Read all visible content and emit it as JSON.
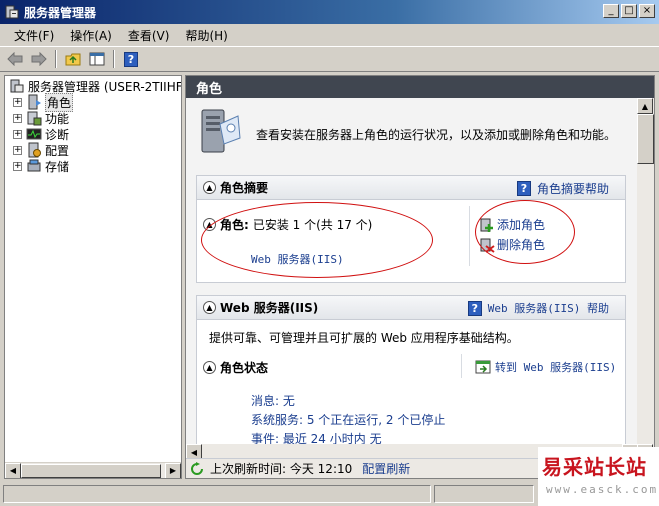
{
  "window": {
    "title": "服务器管理器",
    "minimize": "_",
    "maximize": "□",
    "close": "×"
  },
  "menu": [
    {
      "label": "文件(F)"
    },
    {
      "label": "操作(A)"
    },
    {
      "label": "查看(V)"
    },
    {
      "label": "帮助(H)"
    }
  ],
  "toolbar": {
    "help_glyph": "?"
  },
  "tree": {
    "root": "服务器管理器 (USER-2TIIHF",
    "items": [
      {
        "label": "角色"
      },
      {
        "label": "功能"
      },
      {
        "label": "诊断"
      },
      {
        "label": "配置"
      },
      {
        "label": "存储"
      }
    ],
    "expand_glyph": "+"
  },
  "right": {
    "header": "角色",
    "intro": "查看安装在服务器上角色的运行状况，以及添加或删除角色和功能。",
    "summary": {
      "title": "角色摘要",
      "help": "角色摘要帮助",
      "roles_label": "角色:",
      "roles_value": "已安装 1 个(共 17 个)",
      "web_role": "Web 服务器(IIS)",
      "add_role": "添加角色",
      "remove_role": "删除角色"
    },
    "web": {
      "title": "Web 服务器(IIS)",
      "help": "Web 服务器(IIS) 帮助",
      "description": "提供可靠、可管理并且可扩展的 Web 应用程序基础结构。",
      "status_title": "角色状态",
      "goto": "转到 Web 服务器(IIS)",
      "messages": "消息: 无",
      "services": "系统服务: 5 个正在运行, 2 个已停止",
      "events": "事件: 最近 24 小时内 无"
    },
    "refresh": {
      "label": "上次刷新时间: 今天 12:10",
      "config_link": "配置刷新"
    }
  },
  "watermark": {
    "title": "易采站长站",
    "url": "www.easck.com"
  },
  "colors": {
    "title_bar": "#0a246a",
    "header_bar": "#404650",
    "annotation": "#d01010",
    "link": "#1b3e8f"
  }
}
